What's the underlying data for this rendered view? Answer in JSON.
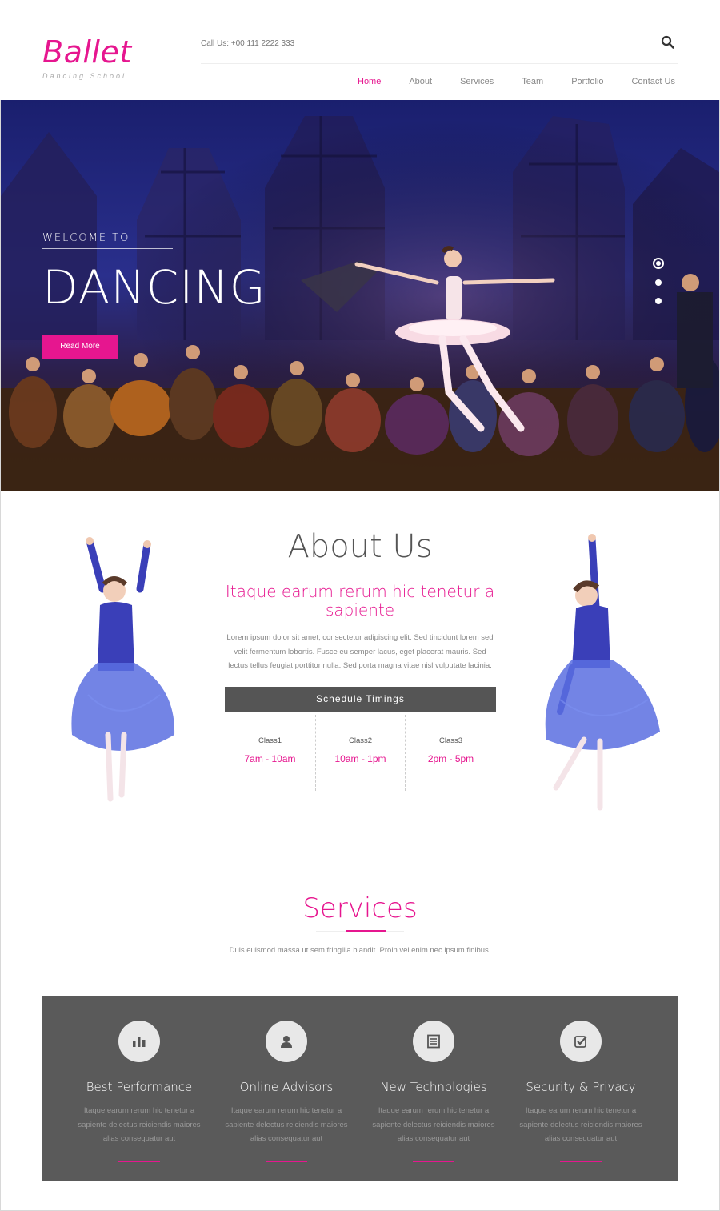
{
  "brand": {
    "name": "Ballet",
    "tagline": "Dancing School"
  },
  "header": {
    "call_us": "Call Us: +00 111 2222 333"
  },
  "nav": {
    "items": [
      {
        "label": "Home",
        "active": true
      },
      {
        "label": "About",
        "active": false
      },
      {
        "label": "Services",
        "active": false
      },
      {
        "label": "Team",
        "active": false
      },
      {
        "label": "Portfolio",
        "active": false
      },
      {
        "label": "Contact Us",
        "active": false
      }
    ]
  },
  "hero": {
    "welcome": "WELCOME TO",
    "title": "DANCING",
    "button": "Read More",
    "slides": 3,
    "active_slide": 1
  },
  "about": {
    "title": "About Us",
    "subtitle": "Itaque earum rerum hic tenetur a sapiente",
    "text": "Lorem ipsum dolor sit amet, consectetur adipiscing elit. Sed tincidunt lorem sed velit fermentum lobortis. Fusce eu semper lacus, eget placerat mauris. Sed lectus tellus feugiat porttitor nulla. Sed porta magna vitae nisl vulputate lacinia.",
    "schedule_title": "Schedule Timings",
    "classes": [
      {
        "name": "Class1",
        "time": "7am - 10am"
      },
      {
        "name": "Class2",
        "time": "10am - 1pm"
      },
      {
        "name": "Class3",
        "time": "2pm - 5pm"
      }
    ]
  },
  "services": {
    "title": "Services",
    "subtitle": "Duis euismod massa ut sem fringilla blandit. Proin vel enim nec ipsum finibus.",
    "items": [
      {
        "icon": "bar-chart-icon",
        "name": "Best Performance",
        "desc": "Itaque earum rerum hic tenetur a sapiente delectus reiciendis maiores alias consequatur aut"
      },
      {
        "icon": "user-icon",
        "name": "Online Advisors",
        "desc": "Itaque earum rerum hic tenetur a sapiente delectus reiciendis maiores alias consequatur aut"
      },
      {
        "icon": "list-icon",
        "name": "New Technologies",
        "desc": "Itaque earum rerum hic tenetur a sapiente delectus reiciendis maiores alias consequatur aut"
      },
      {
        "icon": "check-square-icon",
        "name": "Security & Privacy",
        "desc": "Itaque earum rerum hic tenetur a sapiente delectus reiciendis maiores alias consequatur aut"
      }
    ]
  },
  "colors": {
    "accent": "#e6168f",
    "dark_panel": "#5a5a5a",
    "schedule_bar": "#555555"
  }
}
